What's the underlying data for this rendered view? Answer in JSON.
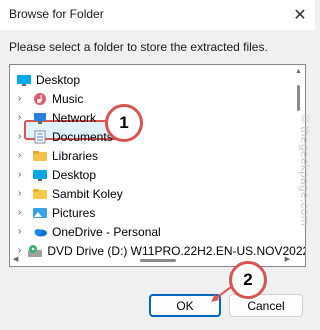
{
  "window": {
    "title": "Browse for Folder",
    "close_glyph": "✕"
  },
  "instruction": "Please select a folder to store the extracted files.",
  "tree": {
    "items": [
      {
        "label": "Desktop",
        "icon": "desktop-icon",
        "chevron": false,
        "level": 0
      },
      {
        "label": "Music",
        "icon": "music-icon",
        "chevron": true,
        "level": 1
      },
      {
        "label": "Network",
        "icon": "network-icon",
        "chevron": true,
        "level": 1
      },
      {
        "label": "Documents",
        "icon": "documents-icon",
        "chevron": true,
        "level": 1,
        "selected": true
      },
      {
        "label": "Libraries",
        "icon": "libraries-icon",
        "chevron": true,
        "level": 1
      },
      {
        "label": "Desktop",
        "icon": "desktop-icon",
        "chevron": true,
        "level": 1
      },
      {
        "label": "Sambit Koley",
        "icon": "user-folder-icon",
        "chevron": true,
        "level": 1
      },
      {
        "label": "Pictures",
        "icon": "pictures-icon",
        "chevron": true,
        "level": 1
      },
      {
        "label": "OneDrive - Personal",
        "icon": "onedrive-icon",
        "chevron": true,
        "level": 1
      },
      {
        "label": "DVD Drive (D:) W11PRO.22H2.EN-US.NOV2022",
        "icon": "dvd-drive-icon",
        "chevron": true,
        "level": 1
      }
    ]
  },
  "buttons": {
    "ok": "OK",
    "cancel": "Cancel"
  },
  "annotations": {
    "step1": "1",
    "step2": "2"
  },
  "watermark": "©thegeekpage.com",
  "colors": {
    "annotation": "#d9534f",
    "accent": "#0067c0",
    "selection": "#cce8ff"
  }
}
